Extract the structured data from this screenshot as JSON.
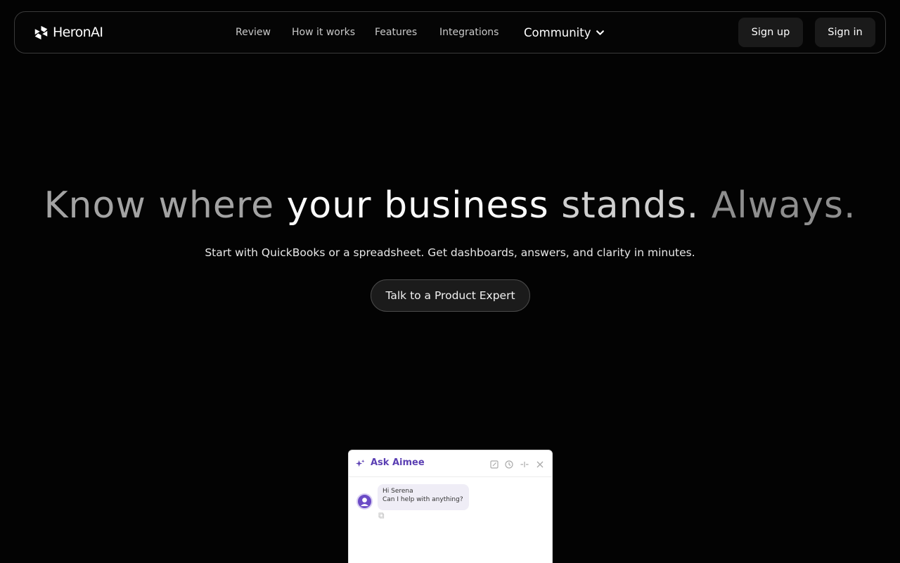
{
  "nav": {
    "brand": "HeronAI",
    "links": [
      "Review",
      "How it works",
      "Features",
      "Integrations"
    ],
    "community_label": "Community",
    "signup_label": "Sign up",
    "signin_label": "Sign in"
  },
  "hero": {
    "headline_part1": "Know where ",
    "headline_part2": "your business",
    "headline_part3": " stands.",
    "headline_part4": " Always.",
    "subheadline": "Start with QuickBooks or a spreadsheet. Get dashboards, answers, and clarity in minutes.",
    "cta_label": "Talk to a Product Expert"
  },
  "widget": {
    "title": "Ask Aimee",
    "greeting_line1": "Hi Serena",
    "greeting_line2": "Can I help with anything?",
    "controls": [
      "edit-icon",
      "history-icon",
      "collapse-icon",
      "close-icon"
    ]
  },
  "colors": {
    "background": "#030303",
    "accent_purple": "#5b3fb3",
    "button_bg": "#1a1a1a"
  }
}
